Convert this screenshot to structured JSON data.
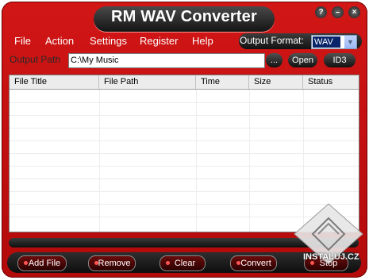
{
  "app": {
    "title": "RM WAV Converter"
  },
  "window_buttons": [
    {
      "name": "help-button",
      "glyph": "?"
    },
    {
      "name": "minimize-button",
      "glyph": "–"
    },
    {
      "name": "close-button",
      "glyph": "×"
    }
  ],
  "menu": {
    "file": "File",
    "action": "Action",
    "settings": "Settings",
    "register": "Register",
    "help": "Help"
  },
  "output_format": {
    "label": "Output Format:",
    "value": "WAV"
  },
  "output_path": {
    "label": "Output Path",
    "value": "C:\\My Music",
    "browse": "...",
    "open": "Open",
    "id3": "ID3"
  },
  "table": {
    "columns": [
      "File Title",
      "File Path",
      "Time",
      "Size",
      "Status"
    ]
  },
  "buttons": {
    "add_file": "Add File",
    "remove": "Remove",
    "clear": "Clear",
    "convert": "Convert",
    "stop": "Stop"
  },
  "watermark": {
    "text": "INSTALUJ.CZ"
  },
  "colors": {
    "frame": "#c8100f",
    "dark": "#1a1a1a",
    "selection": "#0a246a"
  }
}
